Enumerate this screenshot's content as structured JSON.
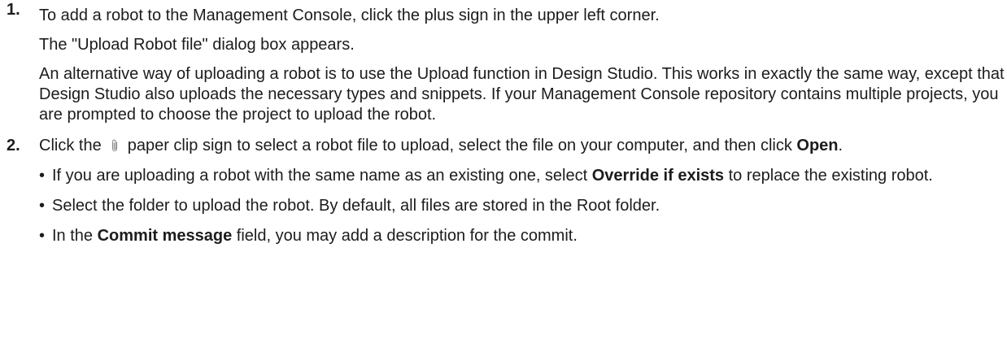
{
  "steps": [
    {
      "number": "1.",
      "paragraphs": [
        "To add a robot to the Management Console, click the plus sign in the upper left corner.",
        "The \"Upload Robot file\" dialog box appears.",
        "An alternative way of uploading a robot is to use the Upload function in Design Studio. This works in exactly the same way, except that Design Studio also uploads the necessary types and snippets. If your Management Console repository contains multiple projects, you are prompted to choose the project to upload the robot."
      ]
    },
    {
      "number": "2.",
      "intro_before_icon": "Click the",
      "icon": "paperclip-icon",
      "intro_after_icon": "paper clip sign to select a robot file to upload, select the file on your computer, and then click ",
      "intro_bold": "Open",
      "intro_end": ".",
      "bullets": [
        {
          "text_before": "If you are uploading a robot with the same name as an existing one, select ",
          "bold": "Override if exists",
          "text_after": " to replace the existing robot."
        },
        {
          "text": "Select the folder to upload the robot. By default, all files are stored in the Root folder."
        },
        {
          "text_before": "In the ",
          "bold": "Commit message",
          "text_after": " field, you may add a description for the commit."
        }
      ],
      "bullet_char": "•"
    }
  ]
}
